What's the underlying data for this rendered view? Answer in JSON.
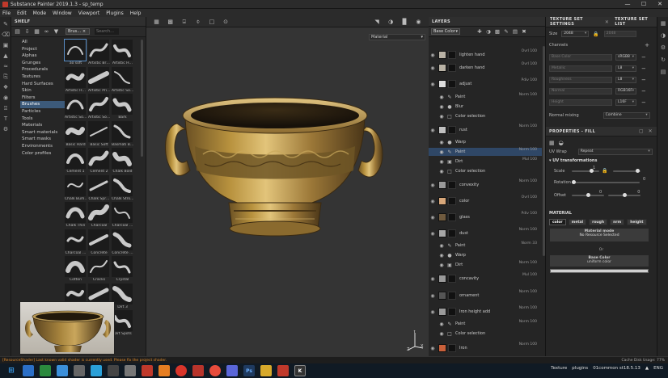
{
  "window": {
    "title": "Substance Painter 2019.1.3 - sp_temp",
    "min": "—",
    "max": "☐",
    "close": "✕"
  },
  "menu": [
    "File",
    "Edit",
    "Mode",
    "Window",
    "Viewport",
    "Plugins",
    "Help"
  ],
  "shelf": {
    "title": "SHELF",
    "filter_tag": "Brus… ×",
    "search_placeholder": "Search...",
    "categories": [
      "All",
      "Project",
      "Alphas",
      "Grunges",
      "Procedurals",
      "Textures",
      "Hard Surfaces",
      "Skin",
      "Filters",
      "Brushes",
      "Particles",
      "Tools",
      "Materials",
      "Smart materials",
      "Smart masks",
      "Environments",
      "Color profiles"
    ],
    "selected_category": "Brushes",
    "brushes": [
      "ao soft",
      "Artistic Br…",
      "Artistic H…",
      "Artistic H…",
      "Artistic Pri…",
      "Artistic So…",
      "Artistic So…",
      "Artistic So…",
      "Bark",
      "Basic Hard",
      "Basic Soft",
      "Basmati B…",
      "Cement 1",
      "Cement 2",
      "Chalk Bold",
      "Chalk Bum…",
      "Chalk Spr…",
      "Chalk Stro…",
      "Chalk Thin",
      "Charcoal",
      "Charcoal …",
      "Charcoal …",
      "Concrete",
      "Concrete …",
      "Cotton",
      "Cracks",
      "Crystal",
      "",
      "",
      "Dirt 3",
      "",
      "",
      "Dirt Spots"
    ]
  },
  "viewport": {
    "mode_select": "Material",
    "axis": {
      "y": "Y",
      "z": "Z",
      "x": "X"
    }
  },
  "layers": {
    "title": "LAYERS",
    "channel": "Base Color",
    "rows": [
      {
        "name": "lighten hand",
        "blend": "Ovrl",
        "opacity": "100"
      },
      {
        "name": "darken hand",
        "blend": "Ovrl",
        "opacity": "100"
      },
      {
        "name": "adjust",
        "blend": "Pdiv",
        "opacity": "100"
      },
      {
        "name": "Paint",
        "blend": "Norm",
        "opacity": "100"
      },
      {
        "name": "Blur",
        "blend": "",
        "opacity": ""
      },
      {
        "name": "Color selection",
        "blend": "",
        "opacity": ""
      },
      {
        "name": "rust",
        "blend": "Norm",
        "opacity": "100"
      },
      {
        "name": "Warp",
        "blend": "",
        "opacity": ""
      },
      {
        "name": "Paint",
        "blend": "Norm",
        "opacity": "100"
      },
      {
        "name": "Dirt",
        "blend": "Mul",
        "opacity": "100"
      },
      {
        "name": "Color selection",
        "blend": "",
        "opacity": ""
      },
      {
        "name": "convexity",
        "blend": "Norm",
        "opacity": "100"
      },
      {
        "name": "color",
        "blend": "Ovrl",
        "opacity": "100"
      },
      {
        "name": "glass",
        "blend": "Pdiv",
        "opacity": "100"
      },
      {
        "name": "dust",
        "blend": "Norm",
        "opacity": "100"
      },
      {
        "name": "Paint",
        "blend": "Norm",
        "opacity": "33"
      },
      {
        "name": "Warp",
        "blend": "",
        "opacity": ""
      },
      {
        "name": "Dirt",
        "blend": "Norm",
        "opacity": "100"
      },
      {
        "name": "concavity",
        "blend": "Mul",
        "opacity": "100"
      },
      {
        "name": "ornament",
        "blend": "Norm",
        "opacity": "100"
      },
      {
        "name": "Iron height add",
        "blend": "Norm",
        "opacity": "100"
      },
      {
        "name": "Paint",
        "blend": "Norm",
        "opacity": "100"
      },
      {
        "name": "Color selection",
        "blend": "",
        "opacity": ""
      },
      {
        "name": "Iron",
        "blend": "Norm",
        "opacity": "100"
      }
    ]
  },
  "texture_set_settings": {
    "tab1": "TEXTURE SET SETTINGS",
    "tab2": "TEXTURE SET LIST",
    "size_label": "Size",
    "size_value": "2048",
    "size_value2": "2048",
    "channels_label": "Channels",
    "channels": [
      {
        "name": "Base Color",
        "format": "sRGB8"
      },
      {
        "name": "Metallic",
        "format": "L8"
      },
      {
        "name": "Roughness",
        "format": "L8"
      },
      {
        "name": "Normal",
        "format": "RGB16F"
      },
      {
        "name": "Height",
        "format": "L16F"
      }
    ],
    "normal_mixing_label": "Normal mixing",
    "normal_mixing_value": "Combine"
  },
  "properties": {
    "title": "PROPERTIES - FILL",
    "uv_wrap_label": "UV Wrap",
    "uv_wrap_value": "Repeat",
    "uv_section": "UV transformations",
    "scale_label": "Scale",
    "scale_value": "1",
    "rotation_label": "Rotation",
    "rotation_value": "0",
    "offset_label": "Offset",
    "offset_value1": "0",
    "offset_value2": "0",
    "material_label": "MATERIAL",
    "material_buttons": [
      "color",
      "metal",
      "rough",
      "nrm",
      "height"
    ],
    "material_mode": "Material mode",
    "no_resource": "No Resource Selected",
    "or_label": "Or",
    "base_color": "Base Color",
    "uniform_color": "uniform color"
  },
  "status": {
    "message": "[ResourceShader] Last known valid shader is currently used. Please fix the project shader.",
    "cache": "Cache Disk Usage:   77%"
  },
  "taskbar": {
    "tray_texture": "Texture",
    "tray_plugins": "plugins",
    "tray_user": "01common st18.5.13",
    "lang": "ENG",
    "time": "▲"
  }
}
